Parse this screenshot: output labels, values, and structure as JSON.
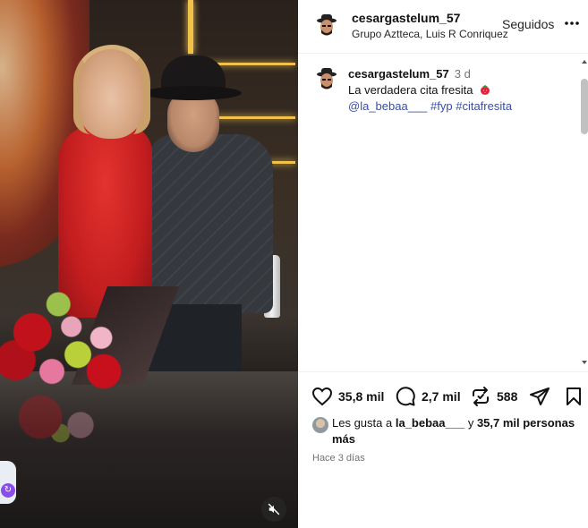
{
  "post": {
    "author": "cesargastelum_57",
    "subtitle": "Grupo Aztteca, Luis R Conriquez",
    "follow_label": "Seguidos",
    "caption": {
      "username": "cesargastelum_57",
      "time_ago": "3 d",
      "text": "La verdadera cita fresita",
      "emoji_icon": "strawberry-icon",
      "mention": "@la_bebaa___",
      "hashtags": [
        "#fyp",
        "#citafresita"
      ]
    },
    "actions": {
      "likes": "35,8 mil",
      "comments": "2,7 mil",
      "reposts": "588"
    },
    "liked_by": {
      "prefix": "Les gusta a",
      "user": "la_bebaa___",
      "connector": "y",
      "others": "35,7 mil personas más"
    },
    "timestamp": "Hace 3 días"
  },
  "colors": {
    "link": "#3a4fa0",
    "muted": "#737373",
    "border": "#efefef"
  }
}
